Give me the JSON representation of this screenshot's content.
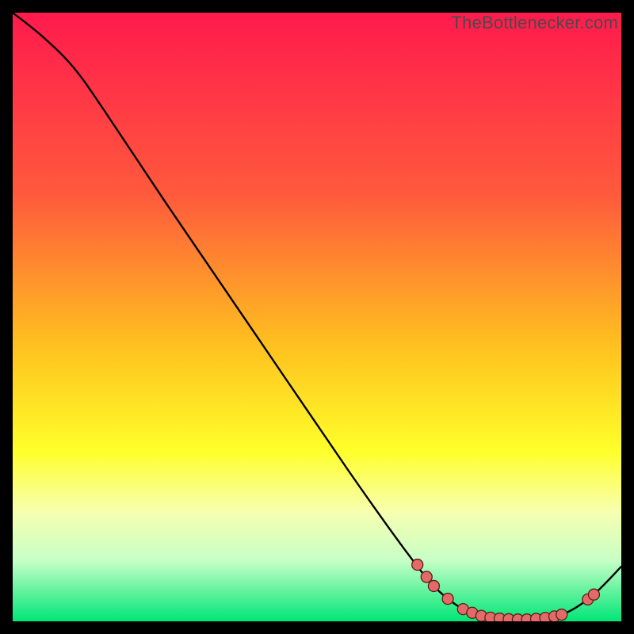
{
  "watermark": "TheBottlenecker.com",
  "chart_data": {
    "type": "line",
    "title": "",
    "xlabel": "",
    "ylabel": "",
    "xlim": [
      0,
      100
    ],
    "ylim": [
      0,
      100
    ],
    "gradient_stops": [
      {
        "offset": 0,
        "color": "#ff1a4d"
      },
      {
        "offset": 30,
        "color": "#ff5a3c"
      },
      {
        "offset": 55,
        "color": "#ffc21f"
      },
      {
        "offset": 72,
        "color": "#ffff2a"
      },
      {
        "offset": 82,
        "color": "#f7ffb0"
      },
      {
        "offset": 90,
        "color": "#c7ffc7"
      },
      {
        "offset": 100,
        "color": "#00e676"
      }
    ],
    "curve": [
      {
        "x": 0.0,
        "y": 100.0
      },
      {
        "x": 5.0,
        "y": 96.0
      },
      {
        "x": 10.0,
        "y": 91.0
      },
      {
        "x": 15.0,
        "y": 84.0
      },
      {
        "x": 25.0,
        "y": 69.0
      },
      {
        "x": 40.0,
        "y": 47.0
      },
      {
        "x": 55.0,
        "y": 25.0
      },
      {
        "x": 65.0,
        "y": 11.0
      },
      {
        "x": 70.0,
        "y": 5.0
      },
      {
        "x": 75.0,
        "y": 1.5
      },
      {
        "x": 80.0,
        "y": 0.4
      },
      {
        "x": 85.0,
        "y": 0.3
      },
      {
        "x": 90.0,
        "y": 1.0
      },
      {
        "x": 95.0,
        "y": 4.0
      },
      {
        "x": 100.0,
        "y": 9.0
      }
    ],
    "markers": [
      {
        "x": 66.5,
        "y": 9.3
      },
      {
        "x": 68.0,
        "y": 7.3
      },
      {
        "x": 69.2,
        "y": 5.8
      },
      {
        "x": 71.5,
        "y": 3.7
      },
      {
        "x": 74.0,
        "y": 2.0
      },
      {
        "x": 75.5,
        "y": 1.4
      },
      {
        "x": 77.0,
        "y": 0.9
      },
      {
        "x": 78.5,
        "y": 0.6
      },
      {
        "x": 80.0,
        "y": 0.45
      },
      {
        "x": 81.5,
        "y": 0.35
      },
      {
        "x": 83.0,
        "y": 0.3
      },
      {
        "x": 84.5,
        "y": 0.3
      },
      {
        "x": 86.0,
        "y": 0.4
      },
      {
        "x": 87.5,
        "y": 0.55
      },
      {
        "x": 89.0,
        "y": 0.8
      },
      {
        "x": 90.2,
        "y": 1.1
      },
      {
        "x": 94.5,
        "y": 3.6
      },
      {
        "x": 95.5,
        "y": 4.4
      }
    ],
    "marker_style": {
      "r": 7,
      "fill": "#e46a6a",
      "stroke": "#5a1f17",
      "stroke_width": 1.3
    }
  }
}
